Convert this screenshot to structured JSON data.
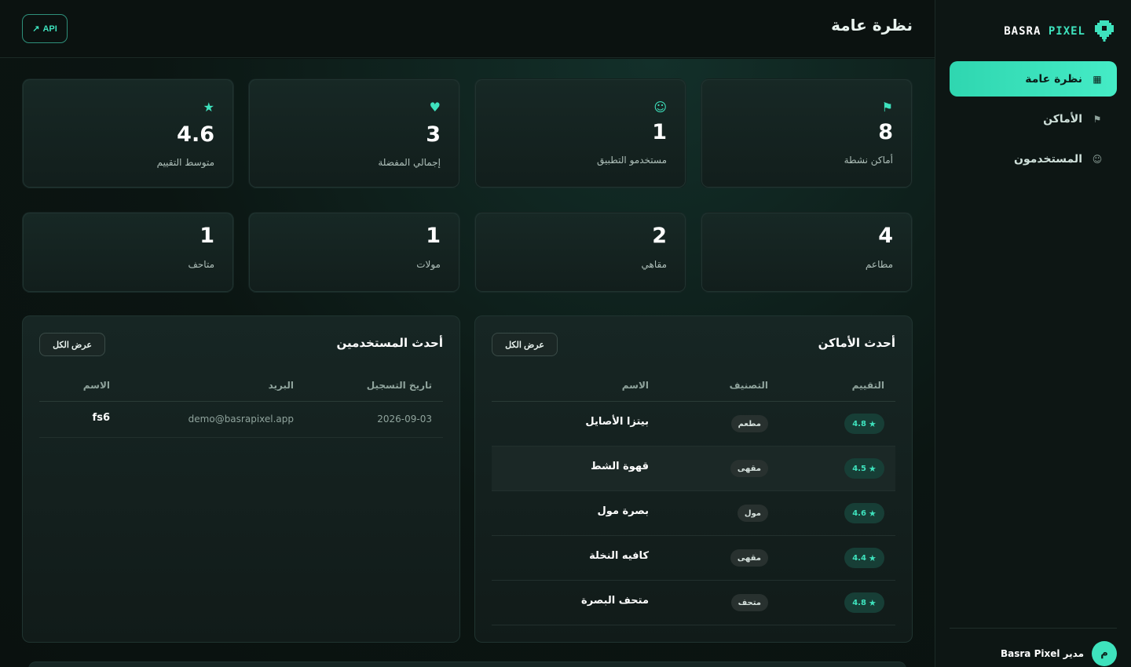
{
  "brand": {
    "word1": "BASRA",
    "word2": "PIXEL",
    "accent": "#3ee2bd",
    "icon": "pixel-pin-icon"
  },
  "nav": [
    {
      "label": "نظرة عامة",
      "icon": "grid-icon",
      "active": true
    },
    {
      "label": "الأماكن",
      "icon": "flag-icon",
      "active": false
    },
    {
      "label": "المستخدمون",
      "icon": "smile-icon",
      "active": false
    }
  ],
  "footer": {
    "avatar_letter": "م",
    "name": "مدير Basra Pixel"
  },
  "header": {
    "title": "نظرة عامة",
    "api_label": "API"
  },
  "stats_top": [
    {
      "value": "8",
      "label": "أماكن نشطة",
      "icon": "flag-icon"
    },
    {
      "value": "1",
      "label": "مستخدمو التطبيق",
      "icon": "smile-icon"
    },
    {
      "value": "3",
      "label": "إجمالي المفضلة",
      "icon": "heart-icon"
    },
    {
      "value": "4.6",
      "label": "متوسط التقييم",
      "icon": "star-icon"
    }
  ],
  "stats_bottom": [
    {
      "value": "4",
      "label": "مطاعم"
    },
    {
      "value": "2",
      "label": "مقاهي"
    },
    {
      "value": "1",
      "label": "مولات"
    },
    {
      "value": "1",
      "label": "متاحف"
    }
  ],
  "places_panel": {
    "title": "أحدث الأماكن",
    "view_all": "عرض الكل",
    "columns": {
      "name": "الاسم",
      "category": "التصنيف",
      "rating": "التقييم"
    },
    "rows": [
      {
        "name": "بيتزا الأصايل",
        "category": "مطعم",
        "rating": "4.8"
      },
      {
        "name": "قهوة الشط",
        "category": "مقهى",
        "rating": "4.5"
      },
      {
        "name": "بصرة مول",
        "category": "مول",
        "rating": "4.6"
      },
      {
        "name": "كافيه النخلة",
        "category": "مقهى",
        "rating": "4.4"
      },
      {
        "name": "متحف البصرة",
        "category": "متحف",
        "rating": "4.8"
      }
    ]
  },
  "users_panel": {
    "title": "أحدث المستخدمين",
    "view_all": "عرض الكل",
    "columns": {
      "name": "الاسم",
      "email": "البريد",
      "date": "تاريخ التسجيل"
    },
    "rows": [
      {
        "name": "fs6",
        "email": "demo@basrapixel.app",
        "date": "2026-09-03"
      }
    ]
  }
}
